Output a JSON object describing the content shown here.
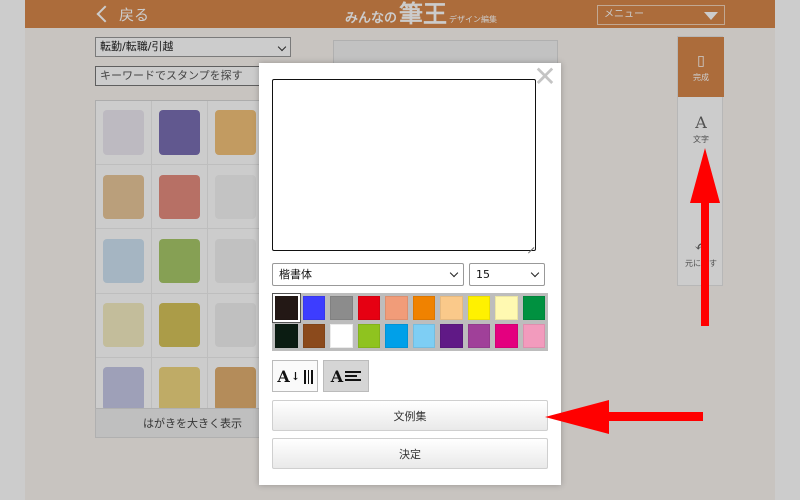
{
  "header": {
    "back_label": "戻る",
    "logo_small": "みんなの",
    "logo_big": "筆王",
    "logo_sub": "デザイン編集",
    "menu_label": "メニュー"
  },
  "left_panel": {
    "category_value": "転勤/転職/引越",
    "keyword_placeholder": "キーワードでスタンプを探す",
    "enlarge_label": "はがきを大きく表示",
    "stamps": [
      {
        "name": "stamp-1",
        "color": "#ede9f2"
      },
      {
        "name": "stamp-2",
        "color": "#7a6fb3"
      },
      {
        "name": "stamp-3",
        "color": "#f3c27a"
      },
      {
        "name": "stamp-4",
        "color": "#e9c79a"
      },
      {
        "name": "stamp-5",
        "color": "#e58d7f"
      },
      {
        "name": "stamp-6",
        "color": "#f4f4f4"
      },
      {
        "name": "stamp-7",
        "color": "#cfe3f3"
      },
      {
        "name": "stamp-8",
        "color": "#a8c96a"
      },
      {
        "name": "stamp-9",
        "color": "#f2f2f2"
      },
      {
        "name": "stamp-10",
        "color": "#f4edc2"
      },
      {
        "name": "stamp-11",
        "color": "#d6c45a"
      },
      {
        "name": "stamp-12",
        "color": "#f1f1f1"
      },
      {
        "name": "stamp-13",
        "color": "#c6c9e6"
      },
      {
        "name": "stamp-14",
        "color": "#efd680"
      },
      {
        "name": "stamp-15",
        "color": "#e1b071"
      }
    ]
  },
  "tools": {
    "done_label": "完成",
    "text_label": "文字",
    "mid_label": "",
    "undo_label": "元に戻す"
  },
  "dialog": {
    "close_glyph": "✕",
    "text_value": "",
    "font_value": "楷書体",
    "size_value": "15",
    "colors": [
      "#231815",
      "#3d3dff",
      "#8c8c8c",
      "#e60012",
      "#f19c79",
      "#f08200",
      "#fac98a",
      "#fff100",
      "#fff9b1",
      "#009140",
      "#0b1c12",
      "#8b4a1c",
      "#ffffff",
      "#8fc31f",
      "#00a0e9",
      "#7ecef4",
      "#601986",
      "#a04099",
      "#e4007f",
      "#f29bbd"
    ],
    "selected_color_index": 0,
    "vertical_glyph": "A",
    "horizontal_glyph": "A",
    "phrase_label": "文例集",
    "ok_label": "決定"
  },
  "annotation": {
    "arrow_color": "#ff0000"
  }
}
